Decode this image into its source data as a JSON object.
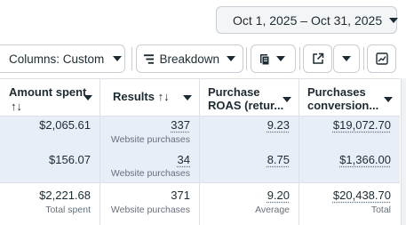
{
  "date_range": {
    "label": "Oct 1, 2025 – Oct 31, 2025"
  },
  "toolbar": {
    "columns_label": "Columns: Custom",
    "breakdown_label": "Breakdown"
  },
  "table": {
    "headers": [
      {
        "line1": "Amount spent",
        "line2": "↑↓"
      },
      {
        "line1": "Results ↑↓",
        "line2": ""
      },
      {
        "line1": "Purchase",
        "line2": "ROAS (retur..."
      },
      {
        "line1": "Purchases",
        "line2": "conversion..."
      }
    ],
    "rows": [
      {
        "amount": "$2,065.61",
        "results": "337",
        "results_sub": "Website purchases",
        "roas": "9.23",
        "conv": "$19,072.70"
      },
      {
        "amount": "$156.07",
        "results": "34",
        "results_sub": "Website purchases",
        "roas": "8.75",
        "conv": "$1,366.00"
      }
    ],
    "totals": {
      "amount": "$2,221.68",
      "amount_sub": "Total spent",
      "results": "371",
      "results_sub": "Website purchases",
      "roas": "9.20",
      "roas_sub": "Average",
      "conv": "$20,438.70",
      "conv_sub": "Total"
    }
  },
  "colors": {
    "row_highlight": "#e8eef8",
    "border": "#dde1e6",
    "muted_text": "#65707b"
  },
  "icons": [
    "calendar-icon",
    "columns-icon",
    "breakdown-icon",
    "reports-icon",
    "export-icon",
    "chart-icon",
    "chevron-down-icon"
  ]
}
